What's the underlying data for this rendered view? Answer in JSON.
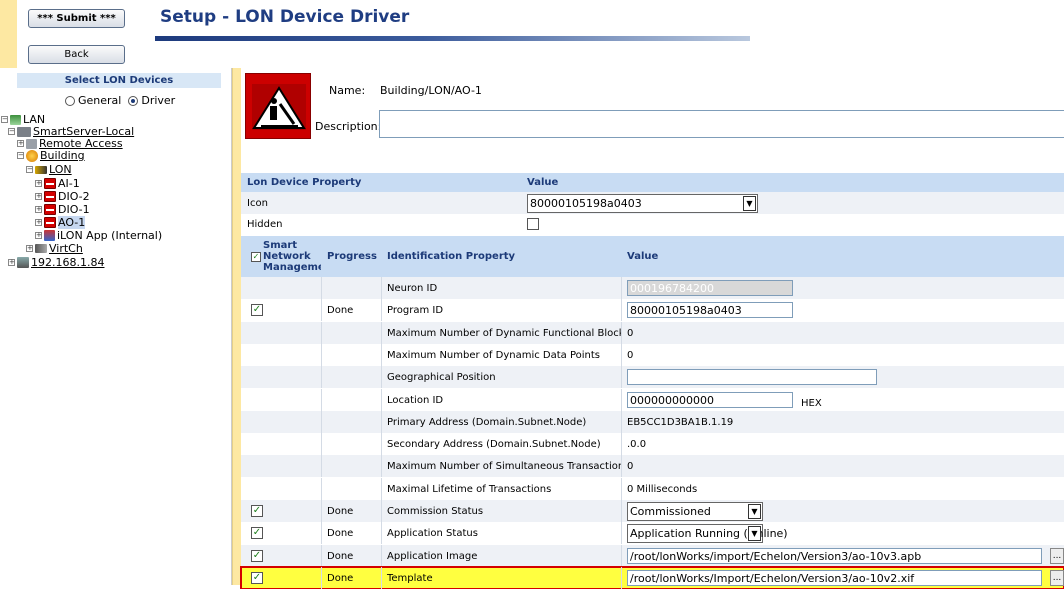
{
  "header": {
    "submit_label": "*** Submit ***",
    "back_label": "Back",
    "title": "Setup - LON Device Driver"
  },
  "left_panel": {
    "title": "Select LON Devices",
    "radio_general": "General",
    "radio_driver": "Driver",
    "tree": {
      "lan": "LAN",
      "smartserver": "SmartServer-Local",
      "remote_access": "Remote Access",
      "building": "Building",
      "lon": "LON",
      "ai1": "AI-1",
      "dio2": "DIO-2",
      "dio1": "DIO-1",
      "ao1": "AO-1",
      "ilon_app": "iLON App (Internal)",
      "virtch": "VirtCh",
      "ip": "192.168.1.84"
    }
  },
  "device": {
    "name_label": "Name:",
    "name_value": "Building/LON/AO-1",
    "description_label": "Description:",
    "description_value": ""
  },
  "lon_property_table": {
    "col_property": "Lon Device Property",
    "col_value": "Value",
    "icon_label": "Icon",
    "icon_value": "80000105198a0403",
    "hidden_label": "Hidden"
  },
  "identification_table": {
    "col_snm": "Smart Network Management",
    "col_progress": "Progress",
    "col_property": "Identification Property",
    "col_value": "Value",
    "rows": [
      {
        "checked": false,
        "progress": "",
        "property": "Neuron ID",
        "value": "000196784200",
        "kind": "disabled"
      },
      {
        "checked": true,
        "progress": "Done",
        "property": "Program ID",
        "value": "80000105198a0403",
        "kind": "input"
      },
      {
        "checked": false,
        "progress": "",
        "property": "Maximum Number of Dynamic Functional Blocks",
        "value": "0",
        "kind": "text"
      },
      {
        "checked": false,
        "progress": "",
        "property": "Maximum Number of Dynamic Data Points",
        "value": "0",
        "kind": "text"
      },
      {
        "checked": false,
        "progress": "",
        "property": "Geographical Position",
        "value": "",
        "kind": "input"
      },
      {
        "checked": false,
        "progress": "",
        "property": "Location ID",
        "value": "000000000000",
        "kind": "input",
        "suffix": "HEX"
      },
      {
        "checked": false,
        "progress": "",
        "property": "Primary Address (Domain.Subnet.Node)",
        "value": "EB5CC1D3BA1B.1.19",
        "kind": "text"
      },
      {
        "checked": false,
        "progress": "",
        "property": "Secondary Address (Domain.Subnet.Node)",
        "value": ".0.0",
        "kind": "text"
      },
      {
        "checked": false,
        "progress": "",
        "property": "Maximum Number of Simultaneous Transactions",
        "value": "0",
        "kind": "text"
      },
      {
        "checked": false,
        "progress": "",
        "property": "Maximal Lifetime of Transactions",
        "value": "0 Milliseconds",
        "kind": "text"
      },
      {
        "checked": true,
        "progress": "Done",
        "property": "Commission Status",
        "value": "Commissioned",
        "kind": "select"
      },
      {
        "checked": true,
        "progress": "Done",
        "property": "Application Status",
        "value": "Application Running (Online)",
        "kind": "select"
      },
      {
        "checked": true,
        "progress": "Done",
        "property": "Application Image",
        "value": "/root/lonWorks/import/Echelon/Version3/ao-10v3.apb",
        "kind": "file"
      },
      {
        "checked": true,
        "progress": "Done",
        "property": "Template",
        "value": "/root/lonWorks/Import/Echelon/Version3/ao-10v2.xif",
        "kind": "file",
        "highlight": true
      }
    ]
  },
  "colors": {
    "accent": "#1f3d82",
    "panel_strip": "#fde8a2",
    "header_bg": "#c8dcf3",
    "highlight": "#ffff40",
    "highlight_border": "#d40000"
  }
}
